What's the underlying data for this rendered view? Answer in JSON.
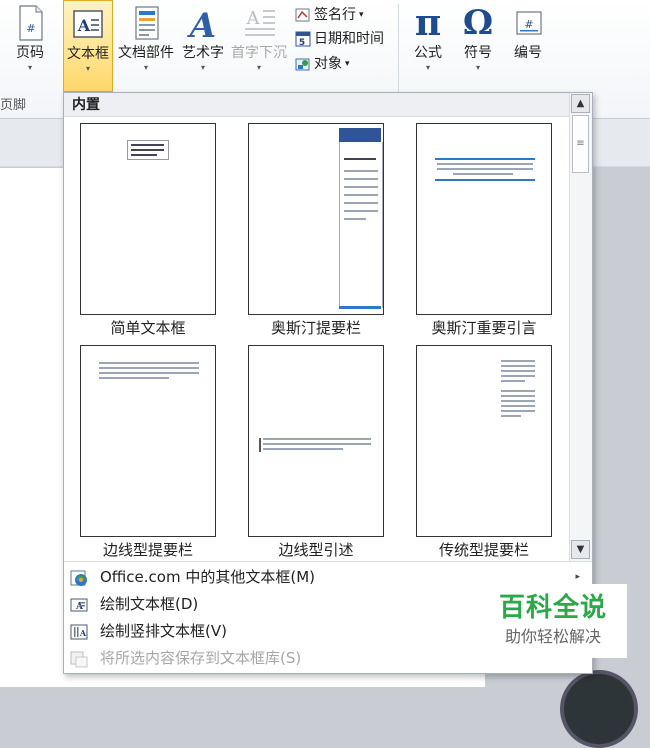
{
  "ribbon": {
    "buttons": [
      {
        "label": "页码",
        "icon": "page-number-icon"
      },
      {
        "label": "文本框",
        "icon": "textbox-icon"
      },
      {
        "label": "文档部件",
        "icon": "quick-parts-icon"
      },
      {
        "label": "艺术字",
        "icon": "wordart-icon"
      },
      {
        "label": "首字下沉",
        "icon": "drop-cap-icon"
      },
      {
        "label": "公式",
        "icon": "pi-icon",
        "glyph": "π"
      },
      {
        "label": "符号",
        "icon": "omega-icon",
        "glyph": "Ω"
      },
      {
        "label": "编号",
        "icon": "numbering-icon"
      }
    ],
    "small_buttons": [
      {
        "label": "签名行",
        "icon": "signature-line-icon",
        "caret": "▾"
      },
      {
        "label": "日期和时间",
        "icon": "date-time-icon"
      },
      {
        "label": "对象",
        "icon": "object-icon",
        "caret": "▾"
      }
    ],
    "group_label_fragment": "页脚"
  },
  "gallery": {
    "header": "内置",
    "items": [
      {
        "label": "简单文本框"
      },
      {
        "label": "奥斯汀提要栏"
      },
      {
        "label": "奥斯汀重要引言"
      },
      {
        "label": "边线型提要栏"
      },
      {
        "label": "边线型引述"
      },
      {
        "label": "传统型提要栏"
      }
    ],
    "menu": [
      {
        "label": "Office.com 中的其他文本框(M)",
        "icon": "office-online-icon",
        "submenu": "▸"
      },
      {
        "label": "绘制文本框(D)",
        "icon": "draw-textbox-icon"
      },
      {
        "label": "绘制竖排文本框(V)",
        "icon": "draw-vertical-textbox-icon"
      },
      {
        "label": "将所选内容保存到文本框库(S)",
        "icon": "save-selection-icon",
        "disabled": true
      }
    ]
  },
  "watermark": {
    "title": "百科全说",
    "subtitle": "助你轻松解决"
  },
  "colors": {
    "active_button": "#ffd86b",
    "accent_blue": "#2f5597",
    "watermark_green": "#2aa84a"
  }
}
